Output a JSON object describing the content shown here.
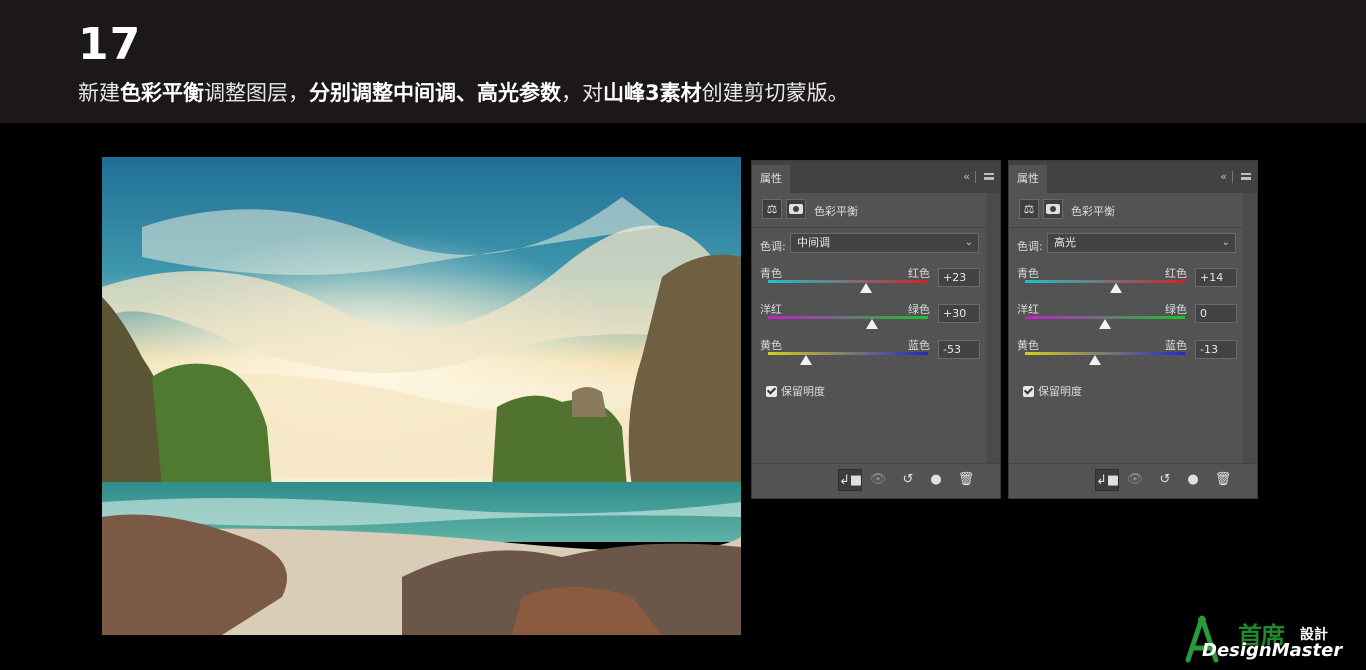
{
  "header": {
    "step_number": "17",
    "instruction": [
      {
        "text": "新建",
        "bold": false
      },
      {
        "text": "色彩平衡",
        "bold": true
      },
      {
        "text": "调整图层，",
        "bold": false
      },
      {
        "text": "分别调整中间调、高光参数",
        "bold": true
      },
      {
        "text": "，对",
        "bold": false
      },
      {
        "text": "山峰3素材",
        "bold": true
      },
      {
        "text": "创建剪切蒙版。",
        "bold": false
      }
    ]
  },
  "panels": [
    {
      "tab": "属性",
      "collapse_icon": "«",
      "title": "色彩平衡",
      "tone_label": "色调:",
      "tone_value": "中间调",
      "sliders": [
        {
          "left": "青色",
          "right": "红色",
          "value": "+23",
          "level": 0.615
        },
        {
          "left": "洋红",
          "right": "绿色",
          "value": "+30",
          "level": 0.65
        },
        {
          "left": "黄色",
          "right": "蓝色",
          "value": "-53",
          "level": 0.235
        }
      ],
      "preserve_label": "保留明度",
      "preserve_checked": true
    },
    {
      "tab": "属性",
      "collapse_icon": "«",
      "title": "色彩平衡",
      "tone_label": "色调:",
      "tone_value": "高光",
      "sliders": [
        {
          "left": "青色",
          "right": "红色",
          "value": "+14",
          "level": 0.57
        },
        {
          "left": "洋红",
          "right": "绿色",
          "value": "0",
          "level": 0.5
        },
        {
          "left": "黄色",
          "right": "蓝色",
          "value": "-13",
          "level": 0.435
        }
      ],
      "preserve_label": "保留明度",
      "preserve_checked": true
    }
  ],
  "logo": {
    "zh": "首席",
    "zh_small": "設計",
    "en": "DesignMaster"
  },
  "colors": {
    "header_bg": "#1c1818",
    "panel_bg": "#535353",
    "logo_green": "#1f8a2c"
  }
}
